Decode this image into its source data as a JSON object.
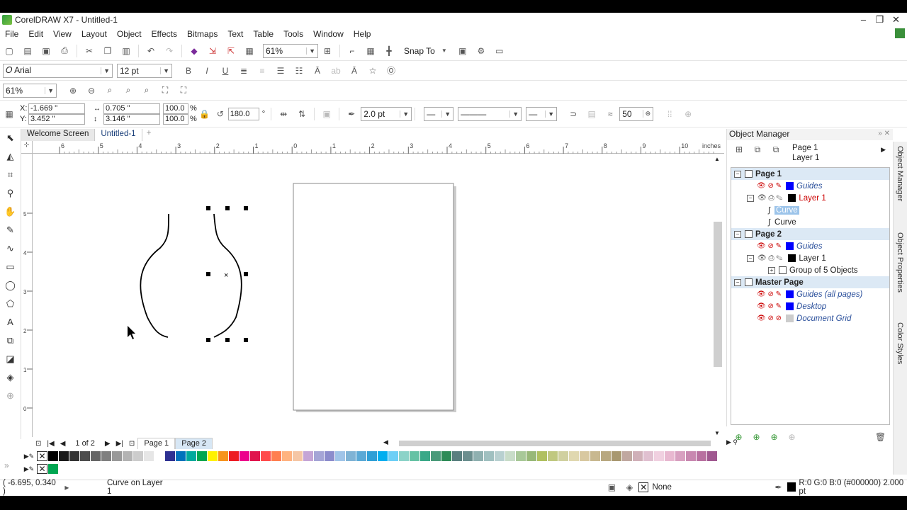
{
  "title": "CorelDRAW X7 - Untitled-1",
  "window_controls": [
    "–",
    "❐",
    "✕"
  ],
  "menu": [
    "File",
    "Edit",
    "View",
    "Layout",
    "Object",
    "Effects",
    "Bitmaps",
    "Text",
    "Table",
    "Tools",
    "Window",
    "Help"
  ],
  "toolbar": {
    "zoom": "61%",
    "snap_to": "Snap To"
  },
  "text_bar": {
    "font": "Arial",
    "size": "12 pt"
  },
  "zoom_bar": {
    "zoom": "61%"
  },
  "property_bar": {
    "x": "-1.669 \"",
    "y": "3.452 \"",
    "w": "0.705 \"",
    "h": "3.146 \"",
    "scale_w": "100.0",
    "scale_h": "100.0",
    "pct": "%",
    "angle": "180.0",
    "deg": "°",
    "outline": "2.0 pt",
    "smooth": "50"
  },
  "doc_tabs": [
    "Welcome Screen",
    "Untitled-1"
  ],
  "ruler": {
    "unit": "inches",
    "h_labels": [
      "6",
      "5",
      "4",
      "3",
      "2",
      "1",
      "0",
      "1",
      "2",
      "3",
      "4",
      "5",
      "6",
      "7",
      "8",
      "9",
      "10"
    ],
    "v_labels": [
      "5",
      "4",
      "3",
      "2",
      "1",
      "0"
    ]
  },
  "pager": {
    "count": "1 of 2",
    "pages": [
      "Page 1",
      "Page 2"
    ]
  },
  "palette": {
    "row1": [
      "#000000",
      "#1a1a1a",
      "#333333",
      "#4d4d4d",
      "#666666",
      "#808080",
      "#999999",
      "#b3b3b3",
      "#cccccc",
      "#e6e6e6",
      "#ffffff",
      "#2e3192",
      "#0072bc",
      "#00a99d",
      "#00a651",
      "#fff200",
      "#f7941d",
      "#ed1c24",
      "#ec008c",
      "#e0144d",
      "#ff4b4b",
      "#ff7f50",
      "#ffb380",
      "#f5c6a5",
      "#c5a5d6",
      "#a5a5d6",
      "#8c8ccc",
      "#a0c4e8",
      "#7fb3d5",
      "#5aa9d6",
      "#2f9fd6",
      "#00aeef",
      "#6dcff6",
      "#8cd3c8",
      "#66c2a4",
      "#3aa888",
      "#4a9a7a",
      "#2e8b57",
      "#5a7f7f",
      "#6b8e8e",
      "#8fb0b0",
      "#a0c0c0",
      "#b8d0d0",
      "#c8dcc8",
      "#a8c898",
      "#98b878",
      "#b0c060",
      "#c0c880",
      "#d0d0a0",
      "#e0d8b0",
      "#d8c8a0",
      "#c8b890",
      "#b8a880",
      "#a89870",
      "#c0a8a0",
      "#d0b0b8",
      "#e0c0d0",
      "#f0d0e0",
      "#e8b8d0",
      "#d8a0c0",
      "#c888b0",
      "#b870a0",
      "#a05890"
    ],
    "row2": [
      "#00a651"
    ]
  },
  "status": {
    "coords": "( -6.695, 0.340 )",
    "info": "Curve on Layer 1",
    "fill": "None",
    "outline_info": "R:0 G:0 B:0 (#000000)  2.000 pt"
  },
  "object_manager": {
    "title": "Object Manager",
    "current_page": "Page 1",
    "current_layer": "Layer 1",
    "tree": [
      {
        "label": "Page 1",
        "kind": "page",
        "indent": 0
      },
      {
        "label": "Guides",
        "kind": "guides",
        "indent": 1
      },
      {
        "label": "Layer 1",
        "kind": "layer-active",
        "indent": 1
      },
      {
        "label": "Curve",
        "kind": "curve-selected",
        "indent": 2
      },
      {
        "label": "Curve",
        "kind": "curve",
        "indent": 2
      },
      {
        "label": "Page 2",
        "kind": "page",
        "indent": 0
      },
      {
        "label": "Guides",
        "kind": "guides",
        "indent": 1
      },
      {
        "label": "Layer 1",
        "kind": "layer",
        "indent": 1
      },
      {
        "label": "Group of 5 Objects",
        "kind": "group",
        "indent": 2
      },
      {
        "label": "Master Page",
        "kind": "page",
        "indent": 0
      },
      {
        "label": "Guides (all pages)",
        "kind": "guides",
        "indent": 1
      },
      {
        "label": "Desktop",
        "kind": "guides",
        "indent": 1
      },
      {
        "label": "Document Grid",
        "kind": "grid",
        "indent": 1
      }
    ]
  },
  "dockers": [
    "Object Manager",
    "Object Properties",
    "Color Styles"
  ]
}
